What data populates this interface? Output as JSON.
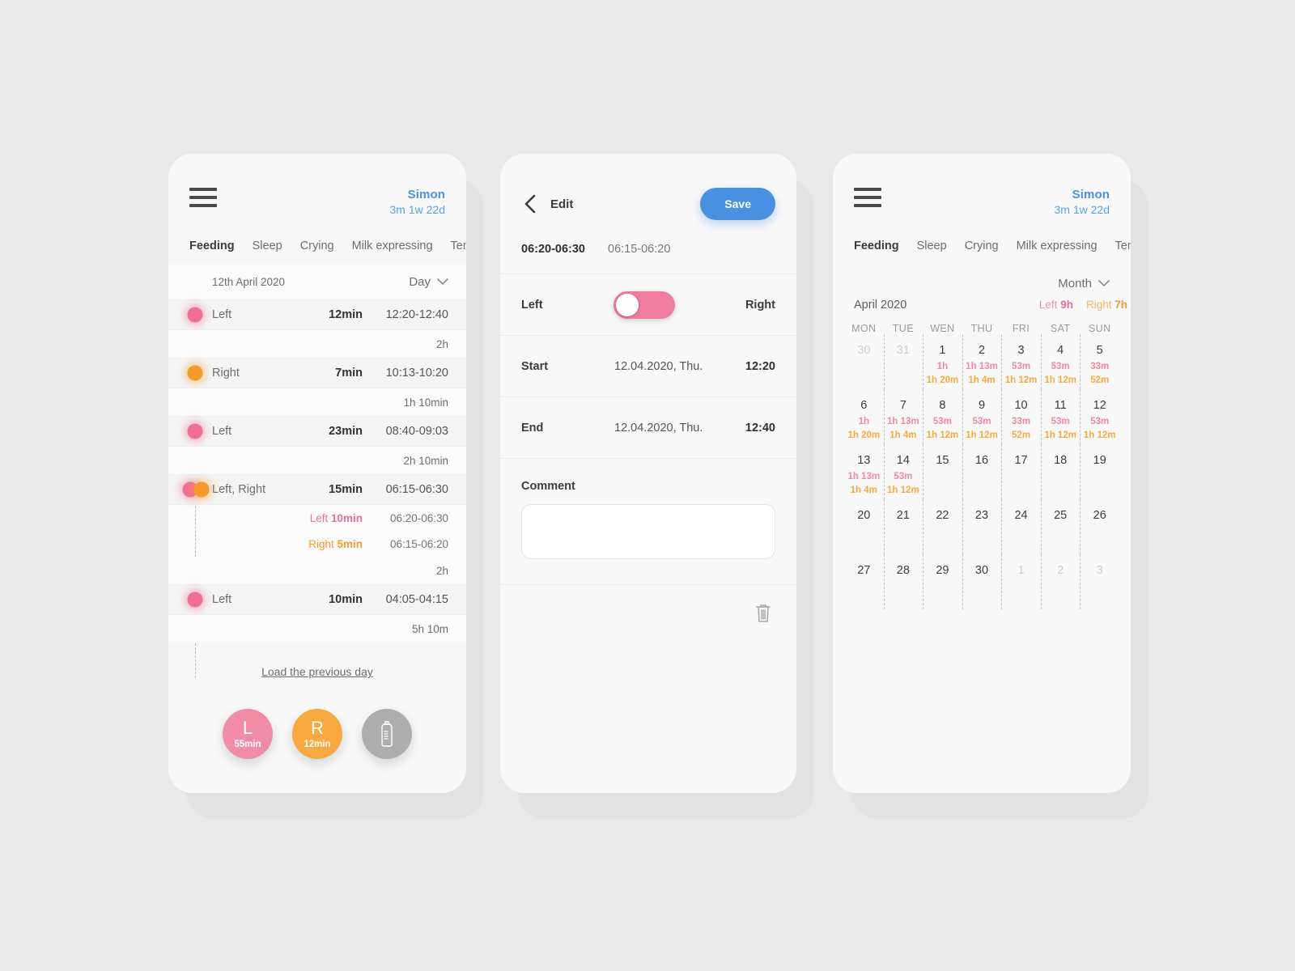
{
  "colors": {
    "background": "#e9e9e9",
    "card": "#f8f8f8",
    "accent_blue": "#4a90e2",
    "left_pink": "#ef6f95",
    "right_orange": "#f79a2e",
    "grey": "#adadad"
  },
  "phone1": {
    "header": {
      "menu_icon": "hamburger-menu-icon",
      "baby_name": "Simon",
      "baby_age": "3m 1w 22d"
    },
    "tabs": [
      {
        "label": "Feeding",
        "active": true
      },
      {
        "label": "Sleep",
        "active": false
      },
      {
        "label": "Crying",
        "active": false
      },
      {
        "label": "Milk expressing",
        "active": false
      },
      {
        "label": "Temperatur",
        "active": false
      }
    ],
    "date_bar": {
      "date": "12th April 2020",
      "period": "Day",
      "chevron_icon": "chevron-down-icon"
    },
    "entries": [
      {
        "type": "event",
        "side": "Left",
        "dot": "left",
        "duration": "12min",
        "time": "12:20-12:40"
      },
      {
        "type": "gap",
        "value": "2h"
      },
      {
        "type": "event",
        "side": "Right",
        "dot": "right",
        "duration": "7min",
        "time": "10:13-10:20"
      },
      {
        "type": "gap",
        "value": "1h 10min"
      },
      {
        "type": "event",
        "side": "Left",
        "dot": "left",
        "duration": "23min",
        "time": "08:40-09:03"
      },
      {
        "type": "gap",
        "value": "2h 10min"
      },
      {
        "type": "event",
        "side": "Left, Right",
        "dot": "both",
        "duration": "15min",
        "time": "06:15-06:30"
      },
      {
        "type": "sub",
        "side": "Left",
        "dot": "left",
        "duration": "10min",
        "time": "06:20-06:30"
      },
      {
        "type": "sub",
        "side": "Right",
        "dot": "right",
        "duration": "5min",
        "time": "06:15-06:20"
      },
      {
        "type": "gap",
        "value": "2h"
      },
      {
        "type": "event",
        "side": "Left",
        "dot": "left",
        "duration": "10min",
        "time": "04:05-04:15"
      },
      {
        "type": "gap",
        "value": "5h 10m"
      }
    ],
    "load_more": "Load the previous day",
    "actions": [
      {
        "id": "left",
        "big": "L",
        "small": "55min",
        "color": "#f08ca8"
      },
      {
        "id": "right",
        "big": "R",
        "small": "12min",
        "color": "#f7a93f"
      },
      {
        "id": "bottle",
        "big": "",
        "small": "",
        "color": "#adadad",
        "icon": "baby-bottle-icon"
      }
    ]
  },
  "phone2": {
    "back_icon": "back-chevron-icon",
    "title": "Edit",
    "save_label": "Save",
    "segments": [
      {
        "label": "06:20-06:30",
        "active": true
      },
      {
        "label": "06:15-06:20",
        "active": false
      }
    ],
    "side_toggle": {
      "left_label": "Left",
      "right_label": "Right",
      "value": "Left"
    },
    "start": {
      "label": "Start",
      "date": "12.04.2020, Thu.",
      "time": "12:20"
    },
    "end": {
      "label": "End",
      "date": "12.04.2020, Thu.",
      "time": "12:40"
    },
    "comment": {
      "label": "Comment",
      "value": "",
      "placeholder": ""
    },
    "delete_icon": "trash-icon"
  },
  "phone3": {
    "header": {
      "menu_icon": "hamburger-menu-icon",
      "baby_name": "Simon",
      "baby_age": "3m 1w 22d"
    },
    "tabs": [
      {
        "label": "Feeding",
        "active": true
      },
      {
        "label": "Sleep",
        "active": false
      },
      {
        "label": "Crying",
        "active": false
      },
      {
        "label": "Milk expressing",
        "active": false
      },
      {
        "label": "Temperatur",
        "active": false
      }
    ],
    "period": {
      "label": "Month",
      "chevron_icon": "chevron-down-icon"
    },
    "month_label": "April 2020",
    "totals": {
      "left_prefix": "Left",
      "left_value": "9h",
      "right_prefix": "Right",
      "right_value": "7h"
    },
    "weekdays": [
      "MON",
      "TUE",
      "WEN",
      "THU",
      "FRI",
      "SAT",
      "SUN"
    ],
    "weeks": [
      [
        {
          "day": "30",
          "outside": true,
          "left": "",
          "right": ""
        },
        {
          "day": "31",
          "outside": true,
          "left": "",
          "right": ""
        },
        {
          "day": "1",
          "outside": false,
          "left": "1h",
          "right": "1h 20m"
        },
        {
          "day": "2",
          "outside": false,
          "left": "1h 13m",
          "right": "1h 4m"
        },
        {
          "day": "3",
          "outside": false,
          "left": "53m",
          "right": "1h 12m"
        },
        {
          "day": "4",
          "outside": false,
          "left": "53m",
          "right": "1h 12m"
        },
        {
          "day": "5",
          "outside": false,
          "left": "33m",
          "right": "52m"
        }
      ],
      [
        {
          "day": "6",
          "outside": false,
          "left": "1h",
          "right": "1h 20m"
        },
        {
          "day": "7",
          "outside": false,
          "left": "1h 13m",
          "right": "1h 4m"
        },
        {
          "day": "8",
          "outside": false,
          "left": "53m",
          "right": "1h 12m"
        },
        {
          "day": "9",
          "outside": false,
          "left": "53m",
          "right": "1h 12m"
        },
        {
          "day": "10",
          "outside": false,
          "left": "33m",
          "right": "52m"
        },
        {
          "day": "11",
          "outside": false,
          "left": "53m",
          "right": "1h 12m"
        },
        {
          "day": "12",
          "outside": false,
          "left": "53m",
          "right": "1h 12m"
        }
      ],
      [
        {
          "day": "13",
          "outside": false,
          "left": "1h 13m",
          "right": "1h 4m"
        },
        {
          "day": "14",
          "outside": false,
          "left": "53m",
          "right": "1h 12m"
        },
        {
          "day": "15",
          "outside": false,
          "left": "",
          "right": ""
        },
        {
          "day": "16",
          "outside": false,
          "left": "",
          "right": ""
        },
        {
          "day": "17",
          "outside": false,
          "left": "",
          "right": ""
        },
        {
          "day": "18",
          "outside": false,
          "left": "",
          "right": ""
        },
        {
          "day": "19",
          "outside": false,
          "left": "",
          "right": ""
        }
      ],
      [
        {
          "day": "20",
          "outside": false,
          "left": "",
          "right": ""
        },
        {
          "day": "21",
          "outside": false,
          "left": "",
          "right": ""
        },
        {
          "day": "22",
          "outside": false,
          "left": "",
          "right": ""
        },
        {
          "day": "23",
          "outside": false,
          "left": "",
          "right": ""
        },
        {
          "day": "24",
          "outside": false,
          "left": "",
          "right": ""
        },
        {
          "day": "25",
          "outside": false,
          "left": "",
          "right": ""
        },
        {
          "day": "26",
          "outside": false,
          "left": "",
          "right": ""
        }
      ],
      [
        {
          "day": "27",
          "outside": false,
          "left": "",
          "right": ""
        },
        {
          "day": "28",
          "outside": false,
          "left": "",
          "right": ""
        },
        {
          "day": "29",
          "outside": false,
          "left": "",
          "right": ""
        },
        {
          "day": "30",
          "outside": false,
          "left": "",
          "right": ""
        },
        {
          "day": "1",
          "outside": true,
          "left": "",
          "right": ""
        },
        {
          "day": "2",
          "outside": true,
          "left": "",
          "right": ""
        },
        {
          "day": "3",
          "outside": true,
          "left": "",
          "right": ""
        }
      ]
    ]
  }
}
